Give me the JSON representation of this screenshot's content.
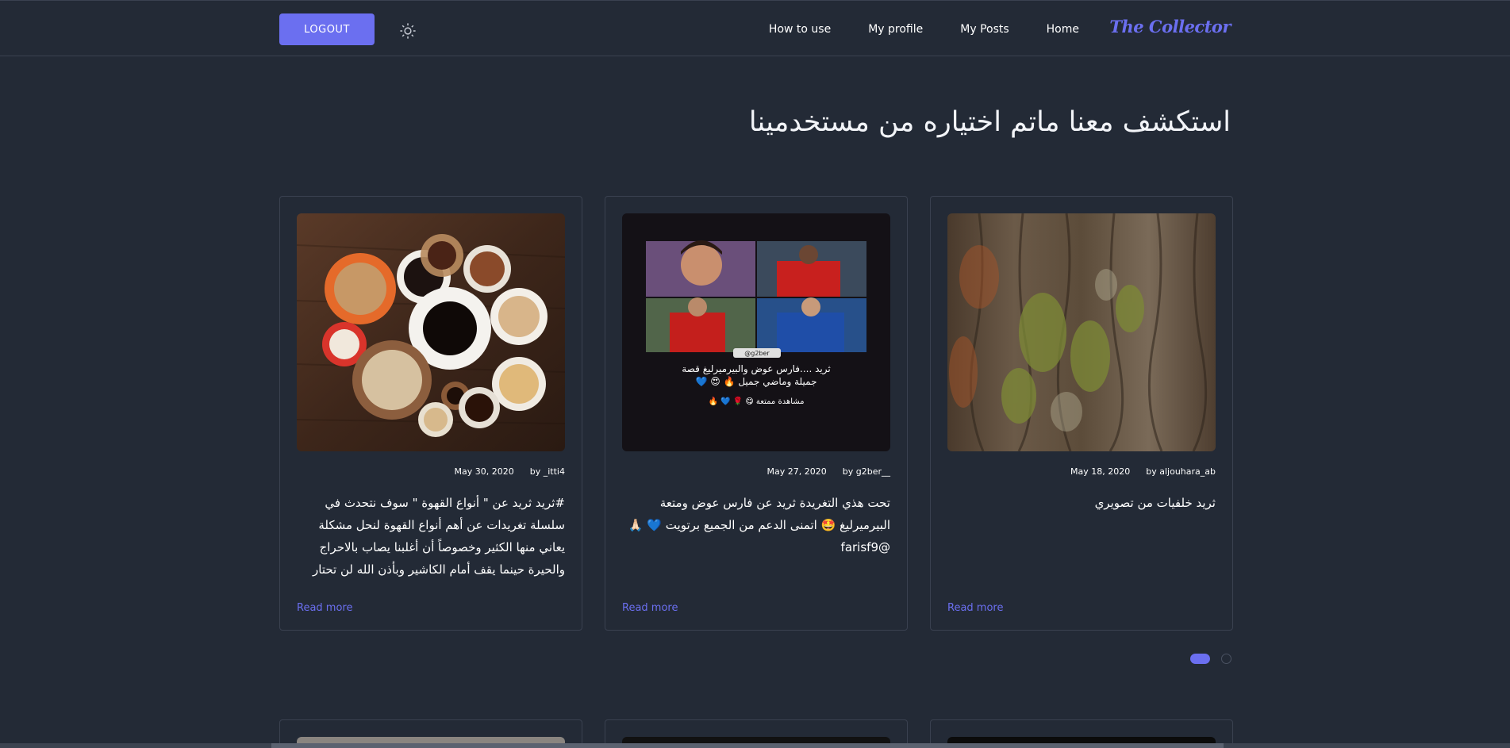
{
  "navbar": {
    "logout_label": "LOGOUT",
    "theme_icon": "sun-icon",
    "links": [
      {
        "label": "How to use"
      },
      {
        "label": "My profile"
      },
      {
        "label": "My Posts"
      },
      {
        "label": "Home"
      }
    ],
    "brand": "The Collector"
  },
  "hero": {
    "title": "استكشف معنا ماتم اختياره من مستخدمينا"
  },
  "cards": [
    {
      "date": "May 30, 2020",
      "author": "by _itti4",
      "text": "#ثريد ثريد عن \" أنواع القهوة \" سوف نتحدث في سلسلة تغريدات عن أهم أنواع القهوة لنحل مشكلة يعاني منها الكثير وخصوصاً أن أغلبنا يصاب بالاحراج والحيرة حينما يقف أمام الكاشير وبأذن الله لن تحتار",
      "read_more": "Read more",
      "image": "coffee-cups-photo"
    },
    {
      "date": "May 27, 2020",
      "author": "by g2ber__",
      "text": "تحت هذي التغريدة ثريد عن فارس عوض ومتعة البيرميرليغ 🤩 اتمنى الدعم من الجميع برتويت 💙 🙏🏻 @farisf9",
      "read_more": "Read more",
      "image": "football-collage-photo",
      "image_caption_line1": "ثريد ....فارس عوض والبيرميرليغ قصة",
      "image_caption_line2": "جميلة وماضي جميل 🔥 😍 💙",
      "image_caption_line3": "مشاهدة ممتعة 😋 🌹 💙 🔥",
      "image_tag": "@g2ber"
    },
    {
      "date": "May 18, 2020",
      "author": "by aljouhara_ab",
      "text": "ثريد خلفيات من تصويري",
      "read_more": "Read more",
      "image": "tree-bark-photo"
    }
  ],
  "carousel": {
    "active_index": 0,
    "total": 2
  },
  "colors": {
    "background": "#232a36",
    "accent": "#6b6ff0",
    "border": "#3a4150",
    "text": "#ffffff"
  }
}
